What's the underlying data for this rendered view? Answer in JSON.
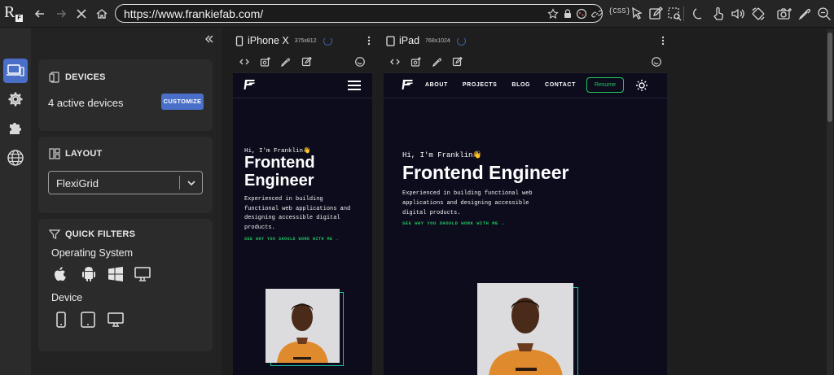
{
  "browser": {
    "url": "https://www.frankiefab.com/",
    "logo_letter": "R",
    "logo_sub": "F",
    "css_label": "{CSS}"
  },
  "panel": {
    "devices": {
      "title": "DEVICES",
      "count_text": "4 active devices",
      "customize_label": "CUSTOMIZE"
    },
    "layout": {
      "title": "LAYOUT",
      "selected": "FlexiGrid"
    },
    "filters": {
      "title": "QUICK FILTERS",
      "os_label": "Operating System",
      "device_label": "Device"
    }
  },
  "devices": [
    {
      "name": "iPhone X",
      "size": "375x812"
    },
    {
      "name": "iPad",
      "size": "768x1024"
    }
  ],
  "site": {
    "nav_links": [
      "ABOUT",
      "PROJECTS",
      "BLOG",
      "CONTACT"
    ],
    "resume": "Resume",
    "greeting": "Hi, I'm Franklin",
    "wave": "👋",
    "hero_line1": "Frontend",
    "hero_line2": "Engineer",
    "hero_full": "Frontend Engineer",
    "blurb": "Experienced in building functional web applications and designing accessible digital products.",
    "phone_blurb_l1": "Experienced in building",
    "phone_blurb_l2": "functional web applications and",
    "phone_blurb_l3": "designing accessible digital",
    "phone_blurb_l4": "products.",
    "tablet_blurb_l1": "Experienced in building functional web",
    "tablet_blurb_l2": "applications and designing accessible",
    "tablet_blurb_l3": "digital products.",
    "cta": "SEE WHY YOU SHOULD WORK WITH ME  →"
  },
  "colors": {
    "accent": "#4a6fc9",
    "site_bg": "#0c0c1d",
    "site_green": "#22c55e",
    "frame_teal": "#1cc3a3"
  }
}
